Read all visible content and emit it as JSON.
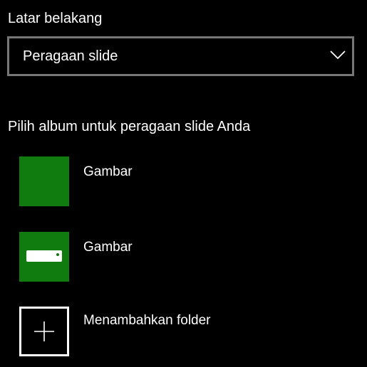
{
  "background_section": {
    "label": "Latar belakang",
    "dropdown": {
      "selected_value": "Peragaan slide",
      "icon": "chevron-down-icon"
    }
  },
  "albums_section": {
    "heading": "Pilih album untuk peragaan slide Anda",
    "items": [
      {
        "label": "Gambar",
        "tile_style": "solid-green",
        "icon": "none"
      },
      {
        "label": "Gambar",
        "tile_style": "green-with-glyph",
        "icon": "media-icon"
      },
      {
        "label": "Menambahkan folder",
        "tile_style": "outline",
        "icon": "plus-icon"
      }
    ]
  },
  "colors": {
    "background": "#000000",
    "accent_green": "#107c10",
    "text": "#ffffff",
    "dropdown_border": "#767676"
  }
}
